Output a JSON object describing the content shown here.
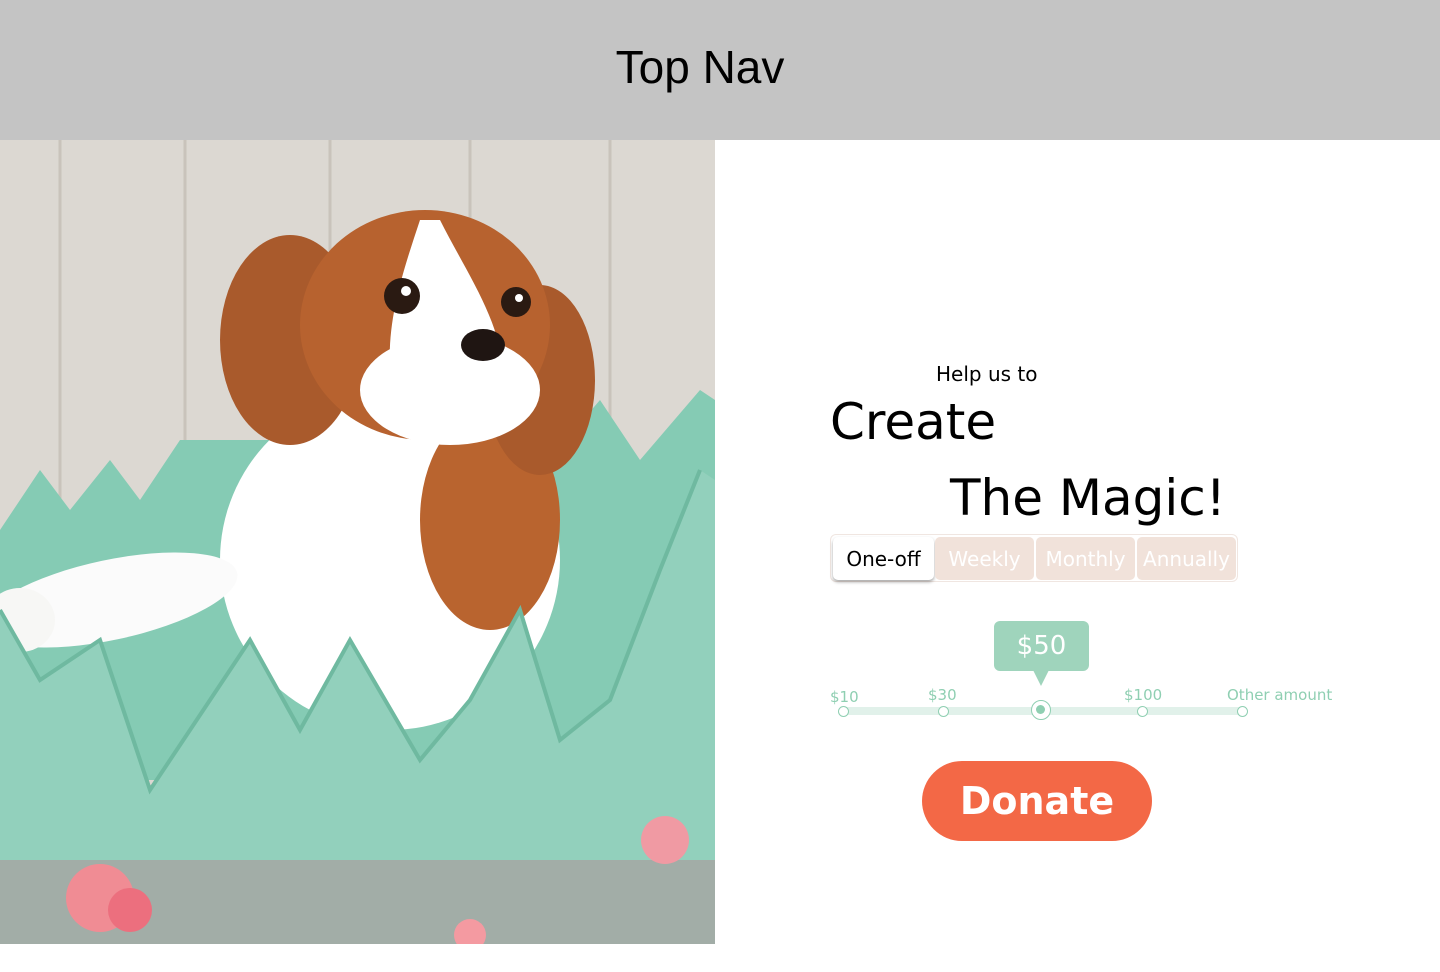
{
  "topnav": {
    "title": "Top Nav"
  },
  "hero": {
    "image_alt": "Puppy sitting in a mint green eggshell"
  },
  "headline": {
    "eyebrow": "Help us to",
    "line1": "Create",
    "line2": "The Magic!"
  },
  "frequency": {
    "tabs": [
      {
        "label": "One-off",
        "active": true
      },
      {
        "label": "Weekly",
        "active": false
      },
      {
        "label": "Monthly",
        "active": false
      },
      {
        "label": "Annually",
        "active": false
      }
    ]
  },
  "amount": {
    "selected_label": "$50",
    "options": [
      "$10",
      "$30",
      "$50",
      "$100",
      "Other amount"
    ],
    "selected_index": 2
  },
  "donate": {
    "label": "Donate"
  },
  "colors": {
    "nav_bg": "#c4c4c4",
    "accent_mint": "#9fd4bc",
    "tab_inactive": "#f1e2da",
    "donate_orange": "#f36846"
  }
}
